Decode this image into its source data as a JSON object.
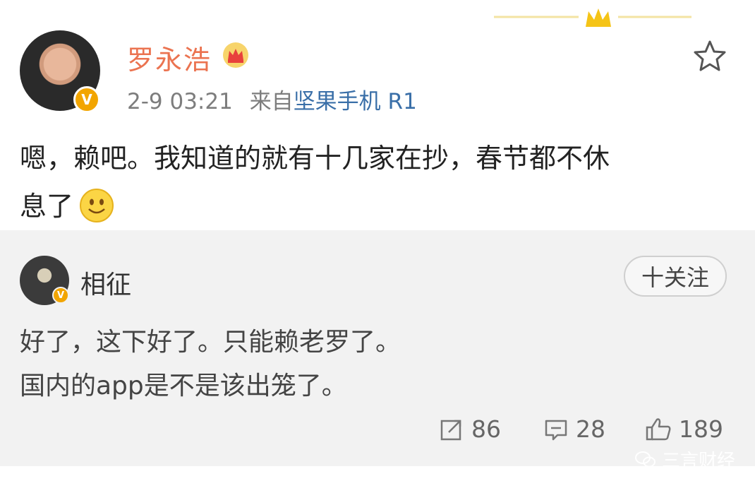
{
  "post": {
    "author": "罗永浩",
    "timestamp": "2-9 03:21",
    "source_prefix": "来自",
    "source_device": "坚果手机 R1",
    "content_line1": "嗯，赖吧。我知道的就有十几家在抄，春节都不休",
    "content_line2": "息了",
    "icons": {
      "avatar_badge": "verified-v-icon",
      "name_badge": "crown-member-icon",
      "favorite": "star-icon",
      "emoji": "smiley-icon",
      "decoration": "crown-divider-icon"
    }
  },
  "comment": {
    "author": "相征",
    "follow_label": "十关注",
    "line1": "好了，这下好了。只能赖老罗了。",
    "line2": "国内的app是不是该出笼了。",
    "actions": {
      "repost_count": "86",
      "comment_count": "28",
      "like_count": "189"
    }
  },
  "watermark": "三言财经",
  "colors": {
    "username": "#eb7350",
    "source_link": "#3a6fa8",
    "badge": "#f2a500",
    "comment_bg": "#f2f2f2"
  }
}
